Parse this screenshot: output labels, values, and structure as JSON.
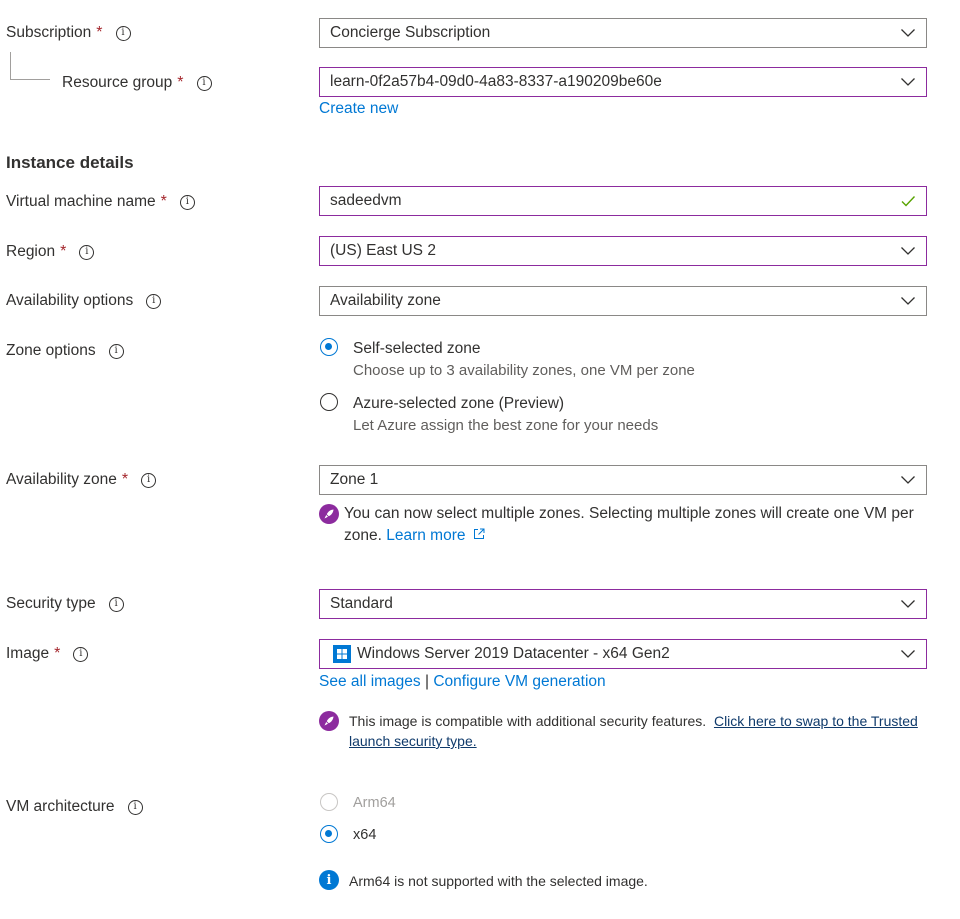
{
  "subscription": {
    "label": "Subscription",
    "required": "*",
    "value": "Concierge Subscription"
  },
  "resource_group": {
    "label": "Resource group",
    "required": "*",
    "value": "learn-0f2a57b4-09d0-4a83-8337-a190209be60e",
    "create_new": "Create new"
  },
  "instance_details": {
    "heading": "Instance details"
  },
  "vm_name": {
    "label": "Virtual machine name",
    "required": "*",
    "value": "sadeedvm"
  },
  "region": {
    "label": "Region",
    "required": "*",
    "value": "(US) East US 2"
  },
  "availability_options": {
    "label": "Availability options",
    "value": "Availability zone"
  },
  "zone_options": {
    "label": "Zone options",
    "options": [
      {
        "label": "Self-selected zone",
        "description": "Choose up to 3 availability zones, one VM per zone",
        "selected": true
      },
      {
        "label": "Azure-selected zone (Preview)",
        "description": "Let Azure assign the best zone for your needs",
        "selected": false
      }
    ]
  },
  "availability_zone": {
    "label": "Availability zone",
    "required": "*",
    "value": "Zone 1",
    "notice": "You can now select multiple zones. Selecting multiple zones will create one VM per zone.",
    "learn_more": "Learn more"
  },
  "security_type": {
    "label": "Security type",
    "value": "Standard"
  },
  "image": {
    "label": "Image",
    "required": "*",
    "value": "Windows Server 2019 Datacenter - x64 Gen2",
    "see_all": "See all images",
    "separator": "|",
    "configure": "Configure VM generation",
    "notice": "This image is compatible with additional security features.",
    "notice_link": "Click here to swap to the Trusted launch security type."
  },
  "vm_architecture": {
    "label": "VM architecture",
    "options": [
      {
        "label": "Arm64",
        "selected": false,
        "disabled": true
      },
      {
        "label": "x64",
        "selected": true,
        "disabled": false
      }
    ],
    "info": "Arm64 is not supported with the selected image."
  },
  "colors": {
    "accent": "#0078d4",
    "purple": "#8c2b9e",
    "required": "#a4262c",
    "success": "#57a300"
  }
}
